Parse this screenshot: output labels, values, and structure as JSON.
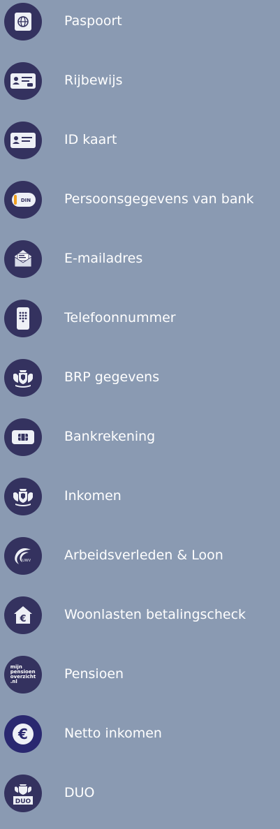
{
  "colors": {
    "background": "#8a9ab2",
    "icon_circle": "#34325f",
    "label": "#ffffff"
  },
  "items": [
    {
      "label": "Paspoort",
      "icon": "passport-icon"
    },
    {
      "label": "Rijbewijs",
      "icon": "drivers-license-icon"
    },
    {
      "label": "ID kaart",
      "icon": "id-card-icon"
    },
    {
      "label": "Persoonsgegevens van bank",
      "icon": "bank-identity-icon"
    },
    {
      "label": "E-mailadres",
      "icon": "envelope-icon"
    },
    {
      "label": "Telefoonnummer",
      "icon": "phone-keypad-icon"
    },
    {
      "label": "BRP gegevens",
      "icon": "coat-of-arms-icon"
    },
    {
      "label": "Bankrekening",
      "icon": "bank-card-icon"
    },
    {
      "label": "Inkomen",
      "icon": "coat-of-arms-icon"
    },
    {
      "label": "Arbeidsverleden & Loon",
      "icon": "uwv-logo-icon"
    },
    {
      "label": "Woonlasten betalingscheck",
      "icon": "house-euro-icon"
    },
    {
      "label": "Pensioen",
      "icon": "mijnpensioenoverzicht-logo-icon",
      "logo_text": [
        "mijn",
        "pensioen",
        "overzicht",
        ".nl"
      ]
    },
    {
      "label": "Netto inkomen",
      "icon": "euro-icon"
    },
    {
      "label": "DUO",
      "icon": "duo-logo-icon",
      "logo_text": "DUO"
    }
  ]
}
